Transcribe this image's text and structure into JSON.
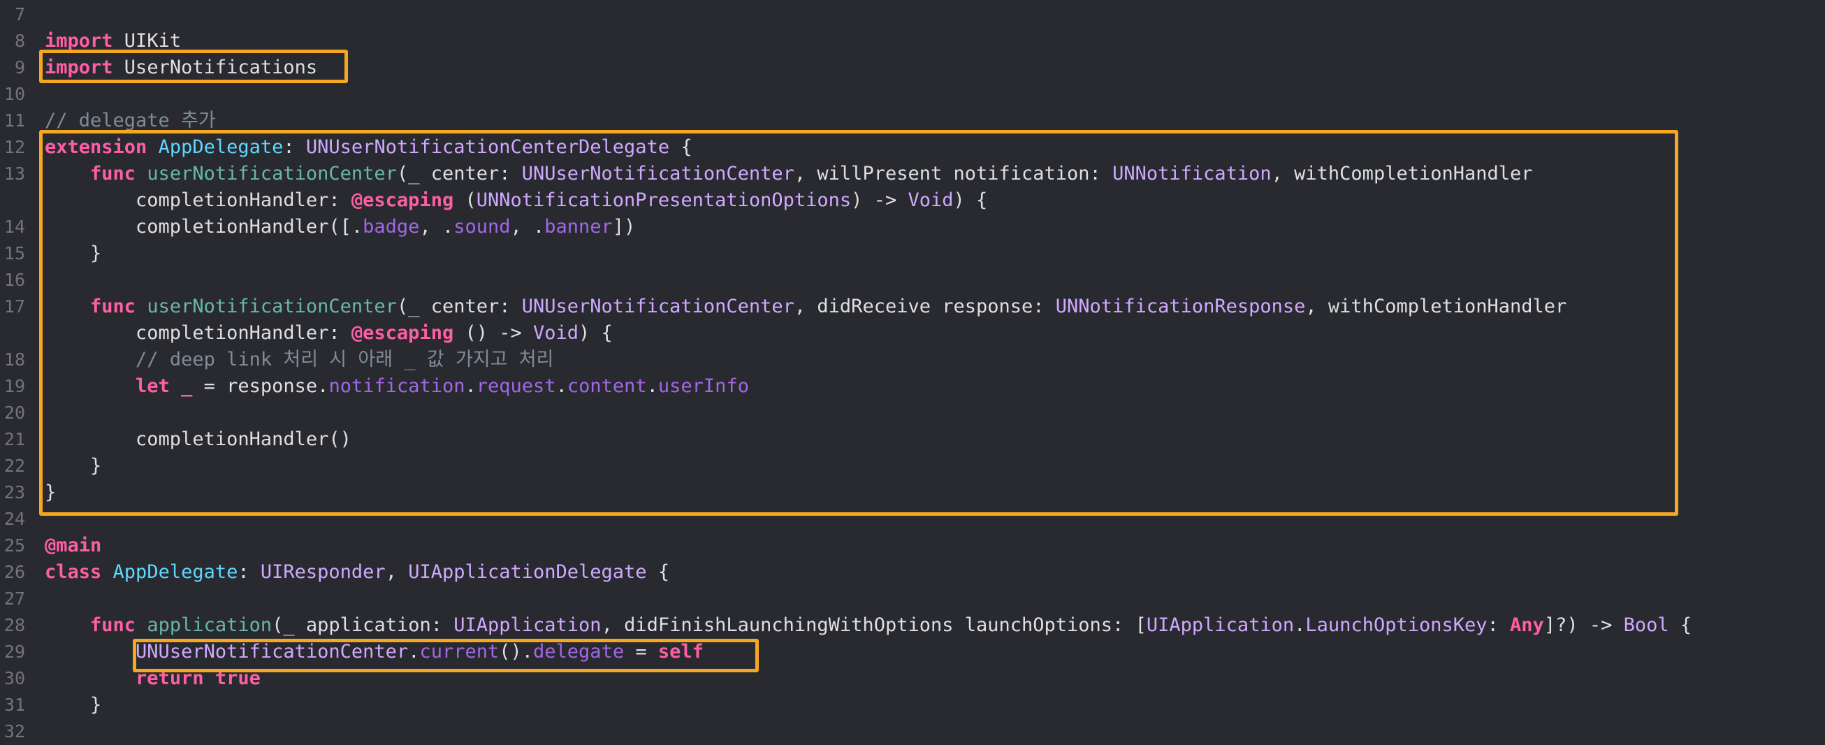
{
  "editor": {
    "language": "Swift",
    "highlight_color": "#f5a623",
    "lines": [
      {
        "n": "7",
        "tokens": []
      },
      {
        "n": "8",
        "tokens": [
          {
            "c": "kw",
            "t": "import"
          },
          {
            "c": "",
            "t": " UIKit"
          }
        ]
      },
      {
        "n": "9",
        "tokens": [
          {
            "c": "kw",
            "t": "import"
          },
          {
            "c": "",
            "t": " UserNotifications"
          }
        ]
      },
      {
        "n": "10",
        "tokens": []
      },
      {
        "n": "11",
        "tokens": [
          {
            "c": "cm",
            "t": "// delegate 추가"
          }
        ]
      },
      {
        "n": "12",
        "tokens": [
          {
            "c": "kw",
            "t": "extension"
          },
          {
            "c": "",
            "t": " "
          },
          {
            "c": "cls",
            "t": "AppDelegate"
          },
          {
            "c": "",
            "t": ": "
          },
          {
            "c": "ty",
            "t": "UNUserNotificationCenterDelegate"
          },
          {
            "c": "",
            "t": " {"
          }
        ]
      },
      {
        "n": "13",
        "tokens": [
          {
            "c": "",
            "t": "    "
          },
          {
            "c": "kw",
            "t": "func"
          },
          {
            "c": "",
            "t": " "
          },
          {
            "c": "fn",
            "t": "userNotificationCenter"
          },
          {
            "c": "",
            "t": "(_ center: "
          },
          {
            "c": "ty",
            "t": "UNUserNotificationCenter"
          },
          {
            "c": "",
            "t": ", willPresent notification: "
          },
          {
            "c": "ty",
            "t": "UNNotification"
          },
          {
            "c": "",
            "t": ", withCompletionHandler"
          }
        ]
      },
      {
        "n": "",
        "tokens": [
          {
            "c": "",
            "t": "        completionHandler: "
          },
          {
            "c": "kw",
            "t": "@escaping"
          },
          {
            "c": "",
            "t": " ("
          },
          {
            "c": "ty",
            "t": "UNNotificationPresentationOptions"
          },
          {
            "c": "",
            "t": ") -> "
          },
          {
            "c": "ty",
            "t": "Void"
          },
          {
            "c": "",
            "t": ") {"
          }
        ]
      },
      {
        "n": "14",
        "tokens": [
          {
            "c": "",
            "t": "        completionHandler([."
          },
          {
            "c": "prop",
            "t": "badge"
          },
          {
            "c": "",
            "t": ", ."
          },
          {
            "c": "prop",
            "t": "sound"
          },
          {
            "c": "",
            "t": ", ."
          },
          {
            "c": "prop",
            "t": "banner"
          },
          {
            "c": "",
            "t": "])"
          }
        ]
      },
      {
        "n": "15",
        "tokens": [
          {
            "c": "",
            "t": "    }"
          }
        ]
      },
      {
        "n": "16",
        "tokens": []
      },
      {
        "n": "17",
        "tokens": [
          {
            "c": "",
            "t": "    "
          },
          {
            "c": "kw",
            "t": "func"
          },
          {
            "c": "",
            "t": " "
          },
          {
            "c": "fn",
            "t": "userNotificationCenter"
          },
          {
            "c": "",
            "t": "(_ center: "
          },
          {
            "c": "ty",
            "t": "UNUserNotificationCenter"
          },
          {
            "c": "",
            "t": ", didReceive response: "
          },
          {
            "c": "ty",
            "t": "UNNotificationResponse"
          },
          {
            "c": "",
            "t": ", withCompletionHandler"
          }
        ]
      },
      {
        "n": "",
        "tokens": [
          {
            "c": "",
            "t": "        completionHandler: "
          },
          {
            "c": "kw",
            "t": "@escaping"
          },
          {
            "c": "",
            "t": " () -> "
          },
          {
            "c": "ty",
            "t": "Void"
          },
          {
            "c": "",
            "t": ") {"
          }
        ]
      },
      {
        "n": "18",
        "tokens": [
          {
            "c": "",
            "t": "        "
          },
          {
            "c": "cm",
            "t": "// deep link 처리 시 아래 _ 값 가지고 처리"
          }
        ]
      },
      {
        "n": "19",
        "tokens": [
          {
            "c": "",
            "t": "        "
          },
          {
            "c": "kw",
            "t": "let"
          },
          {
            "c": "",
            "t": " "
          },
          {
            "c": "kw",
            "t": "_"
          },
          {
            "c": "",
            "t": " = response."
          },
          {
            "c": "prop",
            "t": "notification"
          },
          {
            "c": "",
            "t": "."
          },
          {
            "c": "prop",
            "t": "request"
          },
          {
            "c": "",
            "t": "."
          },
          {
            "c": "prop",
            "t": "content"
          },
          {
            "c": "",
            "t": "."
          },
          {
            "c": "prop",
            "t": "userInfo"
          }
        ]
      },
      {
        "n": "20",
        "tokens": []
      },
      {
        "n": "21",
        "tokens": [
          {
            "c": "",
            "t": "        completionHandler()"
          }
        ]
      },
      {
        "n": "22",
        "tokens": [
          {
            "c": "",
            "t": "    }"
          }
        ]
      },
      {
        "n": "23",
        "tokens": [
          {
            "c": "",
            "t": "}"
          }
        ]
      },
      {
        "n": "24",
        "tokens": []
      },
      {
        "n": "25",
        "tokens": [
          {
            "c": "kw",
            "t": "@main"
          }
        ]
      },
      {
        "n": "26",
        "tokens": [
          {
            "c": "kw",
            "t": "class"
          },
          {
            "c": "",
            "t": " "
          },
          {
            "c": "cls",
            "t": "AppDelegate"
          },
          {
            "c": "",
            "t": ": "
          },
          {
            "c": "ty",
            "t": "UIResponder"
          },
          {
            "c": "",
            "t": ", "
          },
          {
            "c": "ty",
            "t": "UIApplicationDelegate"
          },
          {
            "c": "",
            "t": " {"
          }
        ]
      },
      {
        "n": "27",
        "tokens": []
      },
      {
        "n": "28",
        "tokens": [
          {
            "c": "",
            "t": "    "
          },
          {
            "c": "kw",
            "t": "func"
          },
          {
            "c": "",
            "t": " "
          },
          {
            "c": "fn",
            "t": "application"
          },
          {
            "c": "",
            "t": "(_ application: "
          },
          {
            "c": "ty",
            "t": "UIApplication"
          },
          {
            "c": "",
            "t": ", didFinishLaunchingWithOptions launchOptions: ["
          },
          {
            "c": "ty",
            "t": "UIApplication"
          },
          {
            "c": "",
            "t": "."
          },
          {
            "c": "ty",
            "t": "LaunchOptionsKey"
          },
          {
            "c": "",
            "t": ": "
          },
          {
            "c": "kw",
            "t": "Any"
          },
          {
            "c": "",
            "t": "]?) -> "
          },
          {
            "c": "ty",
            "t": "Bool"
          },
          {
            "c": "",
            "t": " {"
          }
        ]
      },
      {
        "n": "29",
        "tokens": [
          {
            "c": "",
            "t": "        "
          },
          {
            "c": "ty",
            "t": "UNUserNotificationCenter"
          },
          {
            "c": "",
            "t": "."
          },
          {
            "c": "prop",
            "t": "current"
          },
          {
            "c": "",
            "t": "()."
          },
          {
            "c": "prop",
            "t": "delegate"
          },
          {
            "c": "",
            "t": " = "
          },
          {
            "c": "kw",
            "t": "self"
          }
        ]
      },
      {
        "n": "30",
        "tokens": [
          {
            "c": "",
            "t": "        "
          },
          {
            "c": "kw",
            "t": "return"
          },
          {
            "c": "",
            "t": " "
          },
          {
            "c": "kw",
            "t": "true"
          }
        ]
      },
      {
        "n": "31",
        "tokens": [
          {
            "c": "",
            "t": "    }"
          }
        ]
      },
      {
        "n": "32",
        "tokens": []
      }
    ]
  }
}
